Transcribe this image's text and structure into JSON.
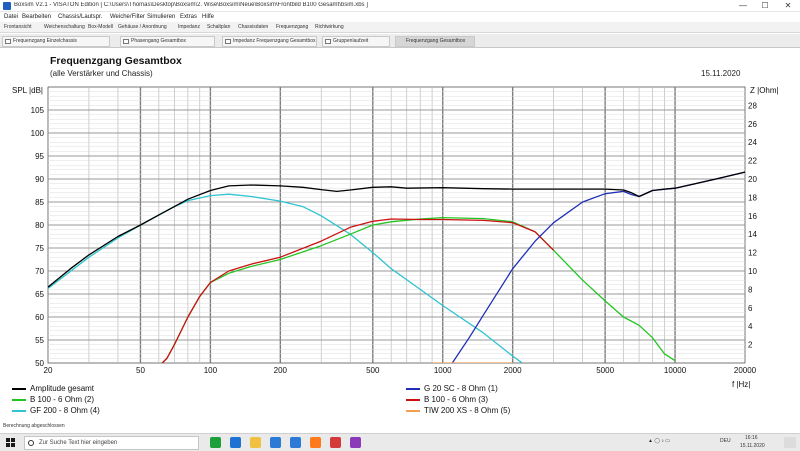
{
  "window": {
    "title": "Boxsim V2.1  - VISATON Edition [ C:\\Users\\Thomas\\Desktop\\Boxsim\\2. Wise\\Boxsim\\Neue\\Boxsim\\Frontbild B100 Gesamt\\bsim.xbs ]",
    "minimize": "—",
    "maximize": "☐",
    "close": "✕"
  },
  "menu": [
    "Datei",
    "Bearbeiten",
    "Chassis/Lautspr.",
    "Weiche/Filter",
    "Simulieren",
    "Extras",
    "Hilfe"
  ],
  "toolbar": [
    "Frontansicht",
    "Weichenschaltung",
    "Box-Modell",
    "Gehäuse / Anordnung",
    "Impedanz",
    "Schaltplan",
    "Chassisdaten",
    "Frequenzgang",
    "Richtwirkung"
  ],
  "tabs": [
    {
      "label": "Frequenzgang Einzelchassis",
      "active": false
    },
    {
      "label": "Phasengang Gesamtbox",
      "active": false
    },
    {
      "label": "Impedanz Frequenzgang Gesamtbox",
      "active": false
    },
    {
      "label": "Gruppenlaufzeit",
      "active": false
    },
    {
      "label": "Frequenzgang Gesamtbox",
      "active": true
    }
  ],
  "status": "Berechnung abgeschlossen",
  "taskbar": {
    "search_placeholder": "Zur Suche Text hier eingeben",
    "tray_text": "DEU",
    "time": "16:16",
    "date": "15.11.2020",
    "app_colors": [
      "#1e73d2",
      "#f0c040",
      "#2b7bd6",
      "#ff7a1a",
      "#d43a3a",
      "#8a3ab9",
      "#1a9f3a"
    ]
  },
  "chart_data": {
    "type": "line",
    "title": "Frequenzgang Gesamtbox",
    "subtitle": "(alle Verstärker und Chassis)",
    "date": "15.11.2020",
    "xlabel": "f |Hz|",
    "ylabel": "SPL |dB|",
    "y2label": "Z |Ohm|",
    "xscale": "log",
    "xlim": [
      20,
      20000
    ],
    "ylim": [
      50,
      110
    ],
    "y2lim": [
      0,
      30
    ],
    "grid": true,
    "xticks": [
      20,
      50,
      100,
      200,
      500,
      1000,
      2000,
      5000,
      10000,
      20000
    ],
    "xtick_labels": [
      "20",
      "50",
      "100",
      "200",
      "500",
      "1000",
      "2000",
      "5000",
      "10000",
      "20000"
    ],
    "yticks": [
      50,
      55,
      60,
      65,
      70,
      75,
      80,
      85,
      90,
      95,
      100,
      105
    ],
    "ytick_labels": [
      "50",
      "55",
      "60",
      "65",
      "70",
      "75",
      "80",
      "85",
      "90",
      "95",
      "100",
      "105"
    ],
    "y2ticks": [
      2,
      4,
      6,
      8,
      10,
      12,
      14,
      16,
      18,
      20,
      22,
      24,
      26,
      28
    ],
    "y2tick_labels": [
      "2",
      "4",
      "6",
      "8",
      "10",
      "12",
      "14",
      "16",
      "18",
      "20",
      "22",
      "24",
      "26",
      "28"
    ],
    "legend_position": "bottom",
    "series": [
      {
        "name": "Amplitude gesamt",
        "color": "#000000",
        "x": [
          20,
          25,
          30,
          40,
          50,
          60,
          70,
          80,
          100,
          120,
          150,
          200,
          250,
          300,
          350,
          400,
          500,
          600,
          700,
          1000,
          1500,
          2000,
          3000,
          4000,
          5000,
          6000,
          6500,
          7000,
          8000,
          9000,
          10000,
          15000,
          20000
        ],
        "y": [
          66.5,
          70.5,
          73.5,
          77.5,
          80.0,
          82.2,
          84.0,
          85.6,
          87.5,
          88.5,
          88.7,
          88.5,
          88.2,
          87.7,
          87.3,
          87.6,
          88.2,
          88.3,
          88.0,
          88.1,
          87.9,
          87.8,
          87.8,
          87.8,
          87.8,
          87.6,
          87.0,
          86.2,
          87.5,
          87.8,
          88.0,
          90.0,
          91.5
        ]
      },
      {
        "name": "B 100 - 6 Ohm (2)",
        "color": "#22c522",
        "x": [
          62,
          65,
          70,
          80,
          90,
          100,
          120,
          150,
          200,
          300,
          400,
          500,
          600,
          800,
          1000,
          1500,
          2000,
          2500,
          3000,
          4000,
          5000,
          6000,
          7000,
          8000,
          9000,
          10000
        ],
        "y": [
          50.0,
          51.0,
          54.0,
          60.0,
          64.5,
          67.5,
          69.5,
          71.0,
          72.5,
          75.5,
          78.0,
          80.0,
          80.7,
          81.3,
          81.6,
          81.4,
          80.7,
          78.5,
          74.5,
          68.0,
          63.5,
          60.0,
          58.2,
          55.5,
          52.0,
          50.5
        ]
      },
      {
        "name": "GF 200 - 8 Ohm (4)",
        "color": "#2fc4cf",
        "x": [
          20,
          30,
          40,
          50,
          60,
          70,
          80,
          100,
          120,
          150,
          200,
          250,
          300,
          400,
          500,
          600,
          800,
          1000,
          1500,
          2000,
          2200
        ],
        "y": [
          66.2,
          73.0,
          77.2,
          80.0,
          82.2,
          84.0,
          85.3,
          86.4,
          86.7,
          86.2,
          85.2,
          84.0,
          82.0,
          78.0,
          74.0,
          70.5,
          66.0,
          62.5,
          56.5,
          51.5,
          50.0
        ]
      },
      {
        "name": "G 20 SC - 8 Ohm (1)",
        "color": "#1f2fb5",
        "x": [
          1100,
          1300,
          1500,
          2000,
          2500,
          3000,
          4000,
          5000,
          6000,
          6500,
          7000,
          8000,
          10000,
          15000,
          20000
        ],
        "y": [
          50.0,
          55.5,
          60.5,
          70.5,
          76.5,
          80.5,
          85.0,
          86.8,
          87.3,
          86.6,
          86.2,
          87.5,
          88.0,
          90.0,
          91.5
        ]
      },
      {
        "name": "B 100 - 6 Ohm (3)",
        "color": "#cc1111",
        "x": [
          62,
          65,
          70,
          80,
          90,
          100,
          120,
          150,
          200,
          300,
          400,
          500,
          600,
          800,
          1000,
          1500,
          2000,
          2500,
          3000
        ],
        "y": [
          50.0,
          51.0,
          54.0,
          60.0,
          64.5,
          67.5,
          70.0,
          71.5,
          73.0,
          76.5,
          79.5,
          80.8,
          81.3,
          81.2,
          81.2,
          81.0,
          80.5,
          78.5,
          74.5
        ]
      },
      {
        "name": "TIW 200 XS - 8 Ohm (5)",
        "color": "#f0a050",
        "x": [
          900,
          1200,
          1600,
          2000
        ],
        "y": [
          50.0,
          50.0,
          50.0,
          50.0
        ]
      }
    ]
  }
}
